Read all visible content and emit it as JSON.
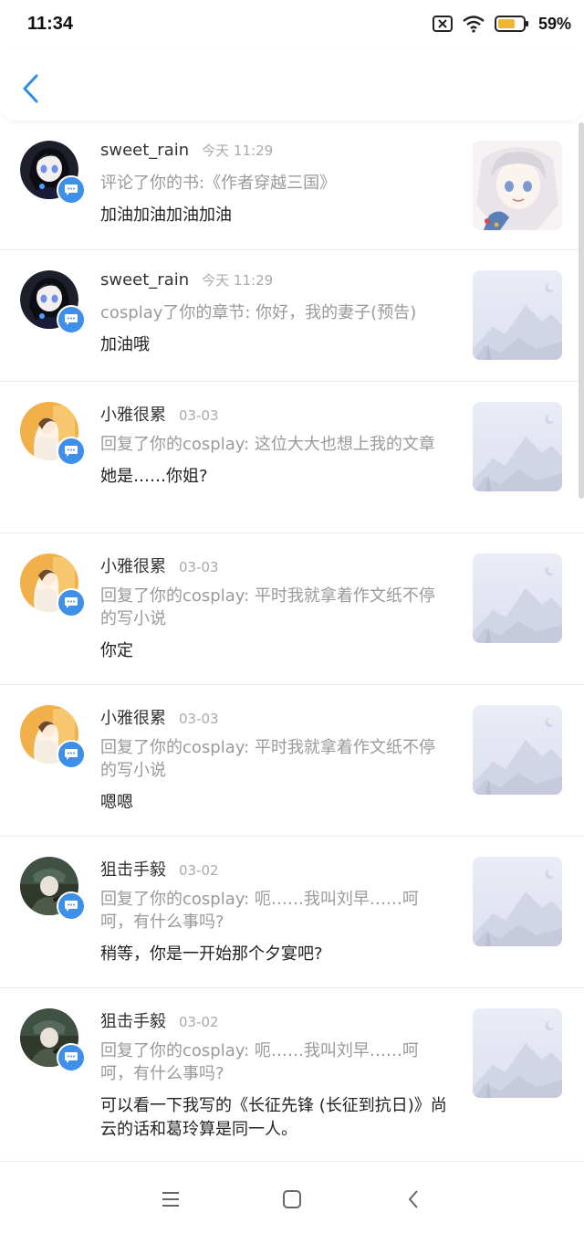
{
  "status_bar": {
    "time": "11:34",
    "battery": "59%"
  },
  "colors": {
    "accent": "#3d8fe8",
    "muted": "#9a9a9a",
    "badge": "#3d8fe8"
  },
  "notifications": [
    {
      "name": "sweet_rain",
      "date": "今天 11:29",
      "ref": "评论了你的书:《作者穿越三国》",
      "message": "加油加油加油加油",
      "avatar": "avatar-dark-girl",
      "thumb": "book-cover-girl"
    },
    {
      "name": "sweet_rain",
      "date": "今天 11:29",
      "ref": "cosplay了你的章节: 你好，我的妻子(预告)",
      "message": "加油哦",
      "avatar": "avatar-dark-girl",
      "thumb": "placeholder-mountain"
    },
    {
      "name": "小雅很累",
      "date": "03-03",
      "ref": "回复了你的cosplay: 这位大大也想上我的文章",
      "message": "她是……你姐?",
      "avatar": "avatar-orange-girl",
      "thumb": "placeholder-mountain"
    },
    {
      "name": "小雅很累",
      "date": "03-03",
      "ref": "回复了你的cosplay: 平时我就拿着作文纸不停的写小说",
      "message": "你定",
      "avatar": "avatar-orange-girl",
      "thumb": "placeholder-mountain"
    },
    {
      "name": "小雅很累",
      "date": "03-03",
      "ref": "回复了你的cosplay: 平时我就拿着作文纸不停的写小说",
      "message": "嗯嗯",
      "avatar": "avatar-orange-girl",
      "thumb": "placeholder-mountain"
    },
    {
      "name": "狙击手毅",
      "date": "03-02",
      "ref": "回复了你的cosplay: 呃……我叫刘早……呵呵，有什么事吗?",
      "message": "稍等，你是一开始那个夕宴吧?",
      "avatar": "avatar-soldier",
      "thumb": "placeholder-mountain"
    },
    {
      "name": "狙击手毅",
      "date": "03-02",
      "ref": "回复了你的cosplay: 呃……我叫刘早……呵呵，有什么事吗?",
      "message": "可以看一下我写的《长征先锋 (长征到抗日)》尚云的话和葛玲算是同一人。",
      "avatar": "avatar-soldier",
      "thumb": "placeholder-mountain"
    }
  ]
}
